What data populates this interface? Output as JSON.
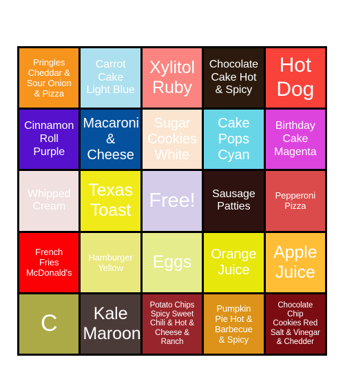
{
  "card": {
    "type": "bingo-card",
    "rows": 5,
    "columns": 5,
    "grid_border_color": "#000000",
    "background_color": "#ffffff",
    "text_color": "#ffffff",
    "cells": [
      {
        "row": 1,
        "col": 1,
        "text": "Pringles\nCheddar &\nSour Onion\n& Pizza",
        "color": "#f7941e",
        "size": "fs-sm"
      },
      {
        "row": 1,
        "col": 2,
        "text": "Carrot\nCake\nLight Blue",
        "color": "#ade0ee",
        "size": "fs-md"
      },
      {
        "row": 1,
        "col": 3,
        "text": "Xylitol\nRuby",
        "color": "#fb8480",
        "size": "fs-xl"
      },
      {
        "row": 1,
        "col": 4,
        "text": "Chocolate\nCake Hot\n& Spicy",
        "color": "#2b1a0d",
        "size": "fs-md"
      },
      {
        "row": 1,
        "col": 5,
        "text": "Hot\nDog",
        "color": "#f9423a",
        "size": "fs-xxl"
      },
      {
        "row": 2,
        "col": 1,
        "text": "Cinnamon\nRoll\nPurple",
        "color": "#5511cc",
        "size": "fs-md"
      },
      {
        "row": 2,
        "col": 2,
        "text": "Macaroni\n&\nCheese",
        "color": "#05519e",
        "size": "fs-lg"
      },
      {
        "row": 2,
        "col": 3,
        "text": "Sugar\nCookies\nWhite",
        "color": "#fbe5d0",
        "size": "fs-lg"
      },
      {
        "row": 2,
        "col": 4,
        "text": "Cake\nPops\nCyan",
        "color": "#69d6e8",
        "size": "fs-lg"
      },
      {
        "row": 2,
        "col": 5,
        "text": "Birthday\nCake\nMagenta",
        "color": "#dd44dd",
        "size": "fs-md"
      },
      {
        "row": 3,
        "col": 1,
        "text": "Whipped\nCream",
        "color": "#f0e0e0",
        "size": "fs-md"
      },
      {
        "row": 3,
        "col": 2,
        "text": "Texas\nToast",
        "color": "#f0eb18",
        "size": "fs-xl"
      },
      {
        "row": 3,
        "col": 3,
        "text": "Free!",
        "color": "#d4cce9",
        "size": "fs-free"
      },
      {
        "row": 3,
        "col": 4,
        "text": "Sausage\nPatties",
        "color": "#2d120f",
        "size": "fs-md"
      },
      {
        "row": 3,
        "col": 5,
        "text": "Pepperoni\nPizza",
        "color": "#dc4b4b",
        "size": "fs-sm"
      },
      {
        "row": 4,
        "col": 1,
        "text": "French\nFries\nMcDonald's",
        "color": "#fb0005",
        "size": "fs-sm"
      },
      {
        "row": 4,
        "col": 2,
        "text": "Hamburger\nYellow",
        "color": "#e9e87c",
        "size": "fs-sm"
      },
      {
        "row": 4,
        "col": 3,
        "text": "Eggs",
        "color": "#e4ec8b",
        "size": "fs-xl"
      },
      {
        "row": 4,
        "col": 4,
        "text": "Orange\nJuice",
        "color": "#e7e70b",
        "size": "fs-lg"
      },
      {
        "row": 4,
        "col": 5,
        "text": "Apple\nJuice",
        "color": "#ffbe35",
        "size": "fs-xl"
      },
      {
        "row": 5,
        "col": 1,
        "text": "C",
        "color": "#aca947",
        "size": "fs-c"
      },
      {
        "row": 5,
        "col": 2,
        "text": "Kale\nMaroon",
        "color": "#4b3b38",
        "size": "fs-xl"
      },
      {
        "row": 5,
        "col": 3,
        "text": "Potato Chips\nSpicy Sweet\nChili & Hot &\nCheese &\nRanch",
        "color": "#98252b",
        "size": "fs-xs"
      },
      {
        "row": 5,
        "col": 4,
        "text": "Pumpkin\nPie Hot &\nBarbecue\n& Spicy",
        "color": "#dd9319",
        "size": "fs-sm"
      },
      {
        "row": 5,
        "col": 5,
        "text": "Chocolate\nChip\nCookies Red\nSalt & Vinegar\n& Chedder",
        "color": "#7b0d12",
        "size": "fs-xs"
      }
    ]
  }
}
